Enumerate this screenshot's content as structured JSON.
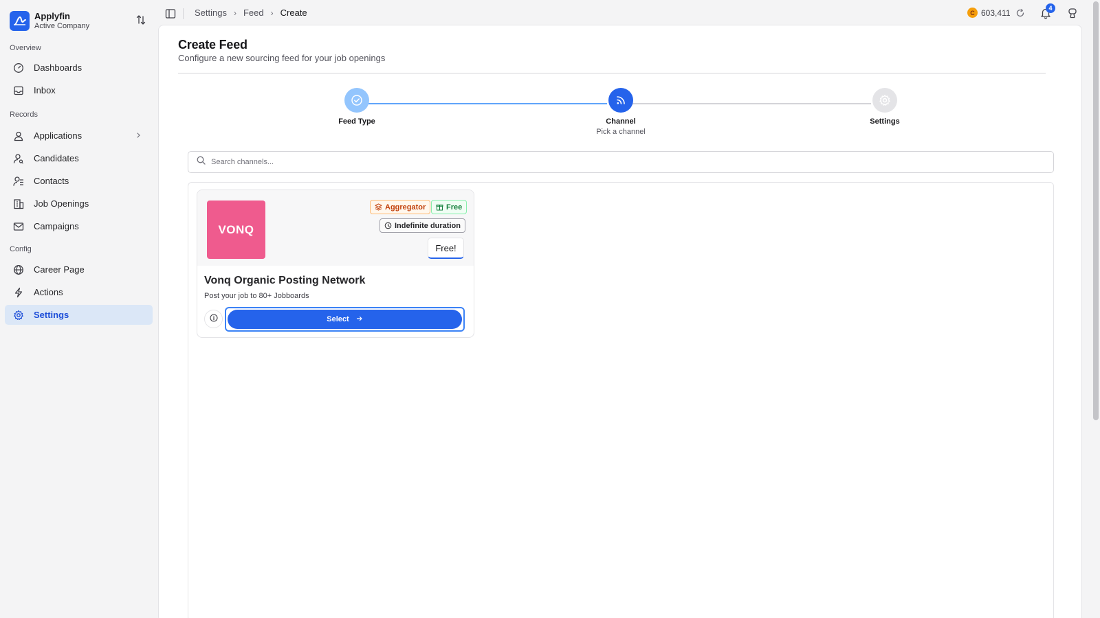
{
  "company": {
    "name": "Applyfin",
    "subtitle": "Active Company"
  },
  "sidebar": {
    "sections": [
      {
        "label": "Overview"
      },
      {
        "label": "Records"
      },
      {
        "label": "Config"
      }
    ],
    "items": [
      {
        "label": "Dashboards",
        "icon": "gauge-icon"
      },
      {
        "label": "Inbox",
        "icon": "inbox-icon"
      },
      {
        "label": "Applications",
        "icon": "user-icon"
      },
      {
        "label": "Candidates",
        "icon": "user-search-icon"
      },
      {
        "label": "Contacts",
        "icon": "contacts-icon"
      },
      {
        "label": "Job Openings",
        "icon": "building-icon"
      },
      {
        "label": "Campaigns",
        "icon": "mail-campaign-icon"
      },
      {
        "label": "Career Page",
        "icon": "globe-icon"
      },
      {
        "label": "Actions",
        "icon": "bolt-icon"
      },
      {
        "label": "Settings",
        "icon": "gear-icon",
        "active": true
      }
    ]
  },
  "breadcrumb": [
    "Settings",
    "Feed",
    "Create"
  ],
  "topbar": {
    "credits": "603,411",
    "coin_symbol": "C",
    "notifications": "4"
  },
  "page": {
    "title": "Create Feed",
    "subtitle": "Configure a new sourcing feed for your job openings"
  },
  "stepper": [
    {
      "label": "Feed Type",
      "desc": "",
      "state": "complete"
    },
    {
      "label": "Channel",
      "desc": "Pick a channel",
      "state": "current"
    },
    {
      "label": "Settings",
      "desc": "",
      "state": "upcoming"
    }
  ],
  "search": {
    "placeholder": "Search channels...",
    "value": ""
  },
  "channel": {
    "logo_text": "VONQ",
    "badges": {
      "aggregator": "Aggregator",
      "free": "Free",
      "duration": "Indefinite duration"
    },
    "price": "Free!",
    "title": "Vonq Organic Posting Network",
    "description": "Post your job to 80+ Jobboards",
    "select_label": "Select"
  },
  "colors": {
    "accent": "#2563eb",
    "active_bg": "#dbe7f7",
    "vonq_pink": "#ef5b8e"
  }
}
